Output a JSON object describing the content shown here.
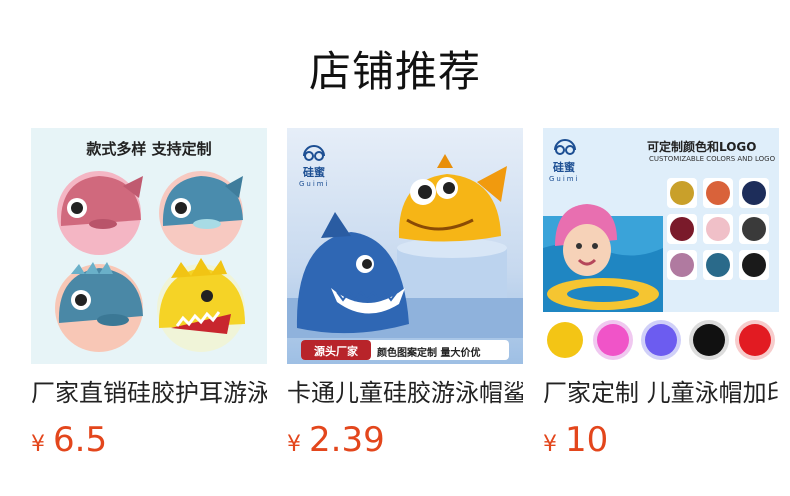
{
  "section": {
    "title": "店铺推荐"
  },
  "products": [
    {
      "name": "厂家直销硅胶护耳游泳帽",
      "currency": "¥",
      "price": "6.5",
      "image": {
        "headline": "款式多样 支持定制"
      }
    },
    {
      "name": "卡通儿童硅胶游泳帽鲨鱼",
      "currency": "¥",
      "price": "2.39",
      "image": {
        "brand": "硅蜜",
        "brand_en": "Guimi",
        "tag": "源头厂家",
        "slogan": "颜色图案定制 量大价优"
      }
    },
    {
      "name": "厂家定制 儿童泳帽加印LOGO",
      "currency": "¥",
      "price": "10",
      "image": {
        "brand": "硅蜜",
        "brand_en": "Guimi",
        "headline": "可定制颜色和LOGO",
        "subline": "CUSTOMIZABLE COLORS AND LOGO"
      }
    }
  ],
  "colors": {
    "price": "#e3461c",
    "title": "#111111",
    "name": "#222222"
  }
}
